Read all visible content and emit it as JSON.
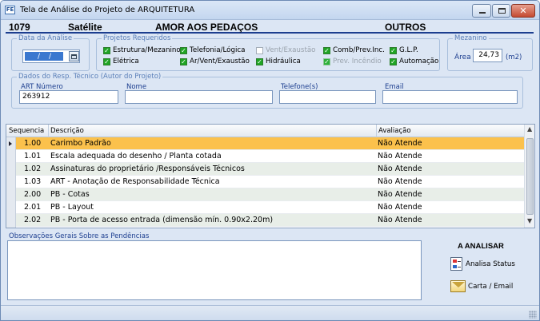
{
  "window": {
    "title": "Tela de Análise do Projeto de ARQUITETURA",
    "icon_text": "FE"
  },
  "header": {
    "number": "1079",
    "city": "Satélite",
    "name": "AMOR AOS PEDAÇOS",
    "category": "OUTROS"
  },
  "data_analise": {
    "title": "Data da Análise",
    "separator": "/"
  },
  "projetos": {
    "title": "Projetos Requeridos",
    "items": [
      {
        "label": "Estrutura/Mezanino",
        "checked": true
      },
      {
        "label": "Elétrica",
        "checked": true
      },
      {
        "label": "Telefonia/Lógica",
        "checked": true
      },
      {
        "label": "Ar/Vent/Exaustão",
        "checked": true
      },
      {
        "label": "Vent/Exaustão",
        "checked": false
      },
      {
        "label": "Hidráulica",
        "checked": true
      },
      {
        "label": "Comb/Prev.Inc.",
        "checked": true
      },
      {
        "label": "Prev. Incêndio",
        "checked": true,
        "disabled": true
      },
      {
        "label": "G.L.P.",
        "checked": true
      },
      {
        "label": "Automação",
        "checked": true
      }
    ]
  },
  "mezanino": {
    "title": "Mezanino",
    "area_label": "Área",
    "area_value": "24,73",
    "unit": "(m2)"
  },
  "resp_tecnico": {
    "title": "Dados do Resp. Técnico (Autor do Projeto)",
    "art_label": "ART Número",
    "art_value": "263912",
    "nome_label": "Nome",
    "nome_value": "",
    "telefone_label": "Telefone(s)",
    "telefone_value": "",
    "email_label": "Email",
    "email_value": ""
  },
  "grid": {
    "columns": [
      "Sequencia",
      "Descrição",
      "Avaliação"
    ],
    "rows": [
      {
        "seq": "1.00",
        "desc": "Carimbo Padrão",
        "aval": "Não Atende"
      },
      {
        "seq": "1.01",
        "desc": "Escala adequada do desenho / Planta cotada",
        "aval": "Não Atende"
      },
      {
        "seq": "1.02",
        "desc": "Assinaturas do proprietário /Responsáveis Técnicos",
        "aval": "Não Atende"
      },
      {
        "seq": "1.03",
        "desc": "ART - Anotação de Responsabilidade Técnica",
        "aval": "Não Atende"
      },
      {
        "seq": "2.00",
        "desc": "PB - Cotas",
        "aval": "Não Atende"
      },
      {
        "seq": "2.01",
        "desc": "PB - Layout",
        "aval": "Não Atende"
      },
      {
        "seq": "2.02",
        "desc": "PB - Porta de acesso entrada (dimensão mín. 0.90x2.20m)",
        "aval": "Não Atende"
      }
    ]
  },
  "observacoes": {
    "label": "Observações Gerais Sobre as Pendências",
    "value": ""
  },
  "actions": {
    "title": "A ANALISAR",
    "status_label": "Analisa Status",
    "email_label": "Carta / Email"
  },
  "icons": {
    "app": "app-icon",
    "calendar": "calendar-icon",
    "status": "status-report-icon",
    "mail": "envelope-icon"
  },
  "colors": {
    "selected_row": "#fbc14c",
    "alt_row": "#e8eee8",
    "label_blue": "#1c3e8f",
    "window_bg": "#dce6f4"
  }
}
